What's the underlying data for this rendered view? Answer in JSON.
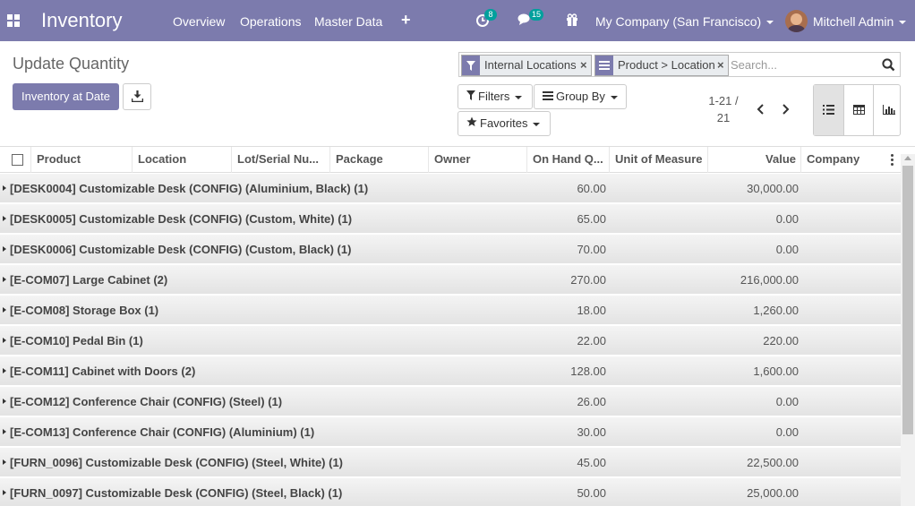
{
  "navbar": {
    "app_title": "Inventory",
    "menu": [
      "Overview",
      "Operations",
      "Master Data"
    ],
    "plus": "+",
    "activity_count": "8",
    "message_count": "15",
    "company": "My Company (San Francisco)",
    "user": "Mitchell Admin"
  },
  "control_panel": {
    "breadcrumb": "Update Quantity",
    "primary_button": "Inventory at Date",
    "search": {
      "facets": [
        {
          "label": "Internal Locations",
          "icon": "filter-icon"
        },
        {
          "label": "Product > Location",
          "icon": "group-by-icon"
        }
      ],
      "placeholder": "Search..."
    },
    "filters_label": "Filters",
    "group_by_label": "Group By",
    "favorites_label": "Favorites",
    "pager_range": "1-21 /",
    "pager_total": "21"
  },
  "list": {
    "columns": [
      "Product",
      "Location",
      "Lot/Serial Nu...",
      "Package",
      "Owner",
      "On Hand Q...",
      "Unit of Measure",
      "Value",
      "Company"
    ],
    "groups": [
      {
        "label": "[DESK0004] Customizable Desk (CONFIG) (Aluminium, Black) (1)",
        "on_hand": "60.00",
        "value": "30,000.00"
      },
      {
        "label": "[DESK0005] Customizable Desk (CONFIG) (Custom, White) (1)",
        "on_hand": "65.00",
        "value": "0.00"
      },
      {
        "label": "[DESK0006] Customizable Desk (CONFIG) (Custom, Black) (1)",
        "on_hand": "70.00",
        "value": "0.00"
      },
      {
        "label": "[E-COM07] Large Cabinet (2)",
        "on_hand": "270.00",
        "value": "216,000.00"
      },
      {
        "label": "[E-COM08] Storage Box (1)",
        "on_hand": "18.00",
        "value": "1,260.00"
      },
      {
        "label": "[E-COM10] Pedal Bin (1)",
        "on_hand": "22.00",
        "value": "220.00"
      },
      {
        "label": "[E-COM11] Cabinet with Doors (2)",
        "on_hand": "128.00",
        "value": "1,600.00"
      },
      {
        "label": "[E-COM12] Conference Chair (CONFIG) (Steel) (1)",
        "on_hand": "26.00",
        "value": "0.00"
      },
      {
        "label": "[E-COM13] Conference Chair (CONFIG) (Aluminium) (1)",
        "on_hand": "30.00",
        "value": "0.00"
      },
      {
        "label": "[FURN_0096] Customizable Desk (CONFIG) (Steel, White) (1)",
        "on_hand": "45.00",
        "value": "22,500.00"
      },
      {
        "label": "[FURN_0097] Customizable Desk (CONFIG) (Steel, Black) (1)",
        "on_hand": "50.00",
        "value": "25,000.00"
      }
    ]
  }
}
